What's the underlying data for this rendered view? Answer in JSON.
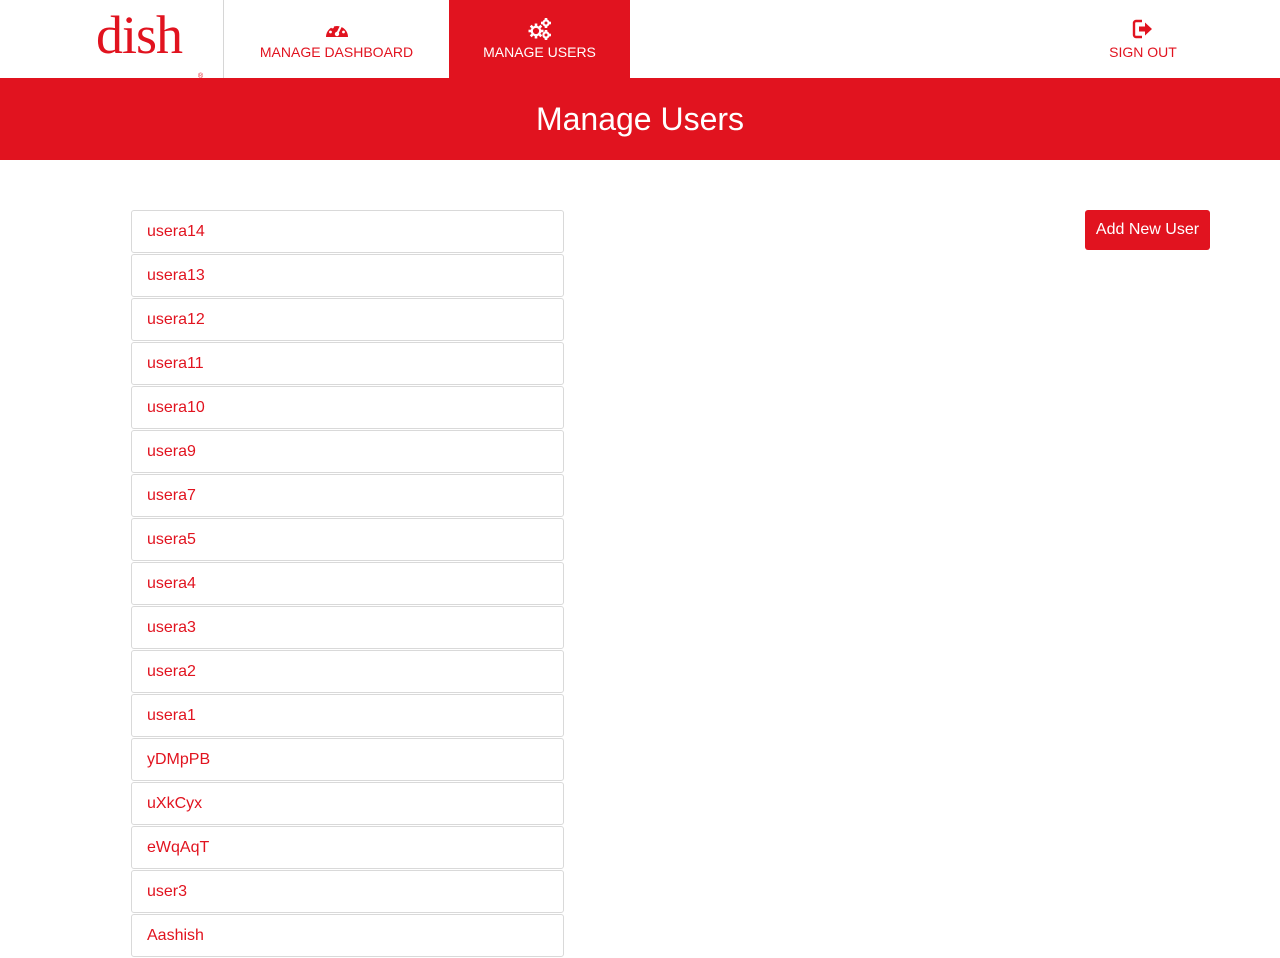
{
  "brand": {
    "logo_text": "dish",
    "trademark": "®",
    "accent_color": "#e1131f"
  },
  "nav": {
    "items": [
      {
        "label": "MANAGE DASHBOARD",
        "icon": "dashboard-gauge-icon",
        "active": false
      },
      {
        "label": "MANAGE USERS",
        "icon": "gears-icon",
        "active": true
      },
      {
        "label": "SIGN OUT",
        "icon": "sign-out-icon",
        "active": false
      }
    ]
  },
  "page": {
    "title": "Manage Users"
  },
  "actions": {
    "add_user_label": "Add New User"
  },
  "users": [
    "usera14",
    "usera13",
    "usera12",
    "usera11",
    "usera10",
    "usera9",
    "usera7",
    "usera5",
    "usera4",
    "usera3",
    "usera2",
    "usera1",
    "yDMpPB",
    "uXkCyx",
    "eWqAqT",
    "user3",
    "Aashish"
  ]
}
